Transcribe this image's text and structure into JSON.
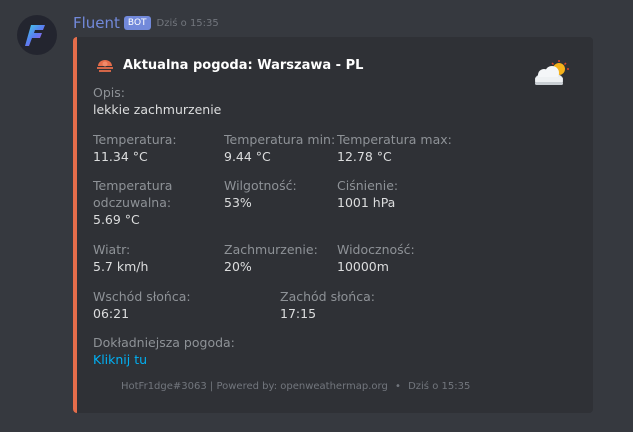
{
  "message": {
    "username": "Fluent",
    "badge": "BOT",
    "timestamp": "Dziś o 15:35"
  },
  "embed": {
    "accent_color": "#e56d4b",
    "author_icon": "weather-report-icon",
    "title": "Aktualna pogoda: Warszawa - PL",
    "thumbnail_icon": "partly-cloudy-icon",
    "fields": {
      "desc": {
        "name": "Opis:",
        "value": "lekkie zachmurzenie"
      },
      "temp": {
        "name": "Temperatura:",
        "value": "11.34 °C"
      },
      "temp_min": {
        "name": "Temperatura min:",
        "value": "9.44 °C"
      },
      "temp_max": {
        "name": "Temperatura max:",
        "value": "12.78 °C"
      },
      "feels_name_line1": "Temperatura",
      "feels_name_line2": "odczuwalna:",
      "feels_value": "5.69 °C",
      "humidity": {
        "name": "Wilgotność:",
        "value": "53%"
      },
      "pressure": {
        "name": "Ciśnienie:",
        "value": "1001 hPa"
      },
      "wind": {
        "name": "Wiatr:",
        "value": "5.7 km/h"
      },
      "clouds": {
        "name": "Zachmurzenie:",
        "value": "20%"
      },
      "visibility": {
        "name": "Widoczność:",
        "value": "10000m"
      },
      "sunrise": {
        "name": "Wschód słońca:",
        "value": "06:21"
      },
      "sunset": {
        "name": "Zachód słońca:",
        "value": "17:15"
      },
      "details": {
        "name": "Dokładniejsza pogoda:",
        "value": "Kliknij tu"
      }
    },
    "footer": {
      "text": "HotFr1dge#3063 | Powered by: openweathermap.org",
      "separator": "•",
      "timestamp": "Dziś o 15:35"
    }
  }
}
